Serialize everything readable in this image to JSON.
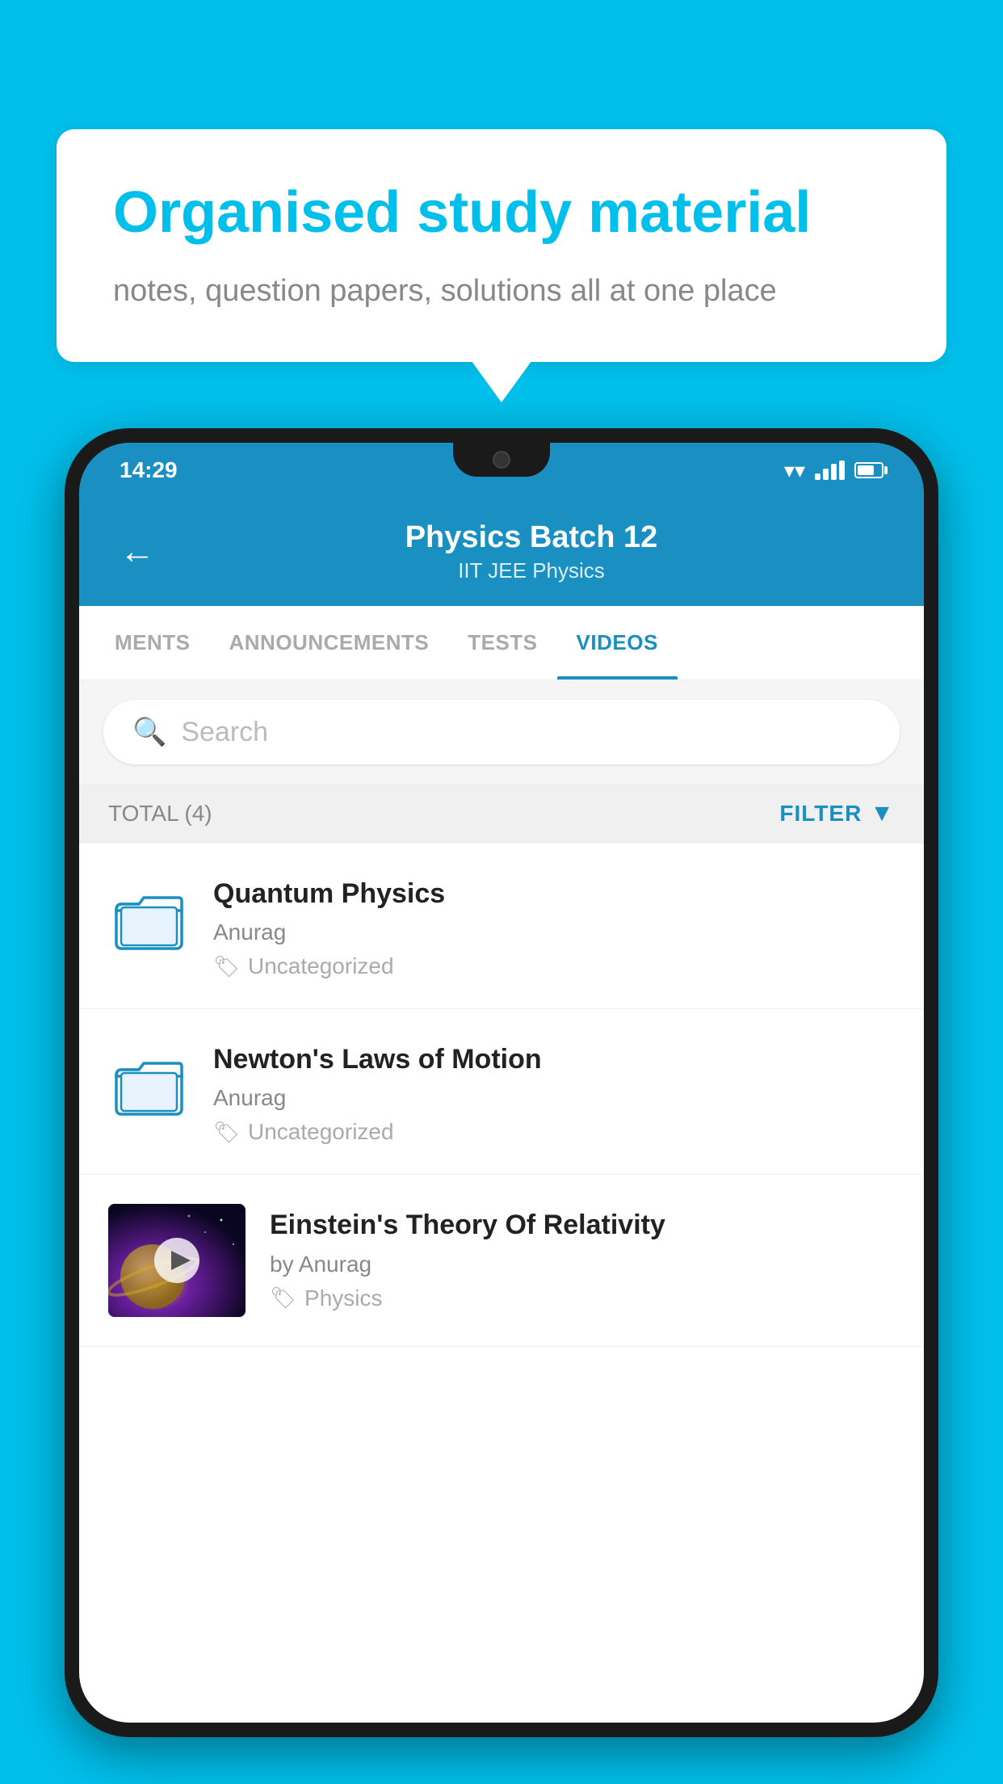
{
  "background_color": "#00BFEA",
  "speech_bubble": {
    "title": "Organised study material",
    "subtitle": "notes, question papers, solutions all at one place"
  },
  "phone": {
    "status_bar": {
      "time": "14:29"
    },
    "header": {
      "back_label": "←",
      "title": "Physics Batch 12",
      "subtitle": "IIT JEE   Physics"
    },
    "tabs": [
      {
        "label": "MENTS",
        "active": false
      },
      {
        "label": "ANNOUNCEMENTS",
        "active": false
      },
      {
        "label": "TESTS",
        "active": false
      },
      {
        "label": "VIDEOS",
        "active": true
      }
    ],
    "search": {
      "placeholder": "Search"
    },
    "filter": {
      "total_label": "TOTAL (4)",
      "filter_label": "FILTER"
    },
    "videos": [
      {
        "title": "Quantum Physics",
        "author": "Anurag",
        "tag": "Uncategorized",
        "type": "folder",
        "thumbnail": null
      },
      {
        "title": "Newton's Laws of Motion",
        "author": "Anurag",
        "tag": "Uncategorized",
        "type": "folder",
        "thumbnail": null
      },
      {
        "title": "Einstein's Theory Of Relativity",
        "author": "by Anurag",
        "tag": "Physics",
        "type": "video",
        "thumbnail": "space"
      }
    ]
  }
}
